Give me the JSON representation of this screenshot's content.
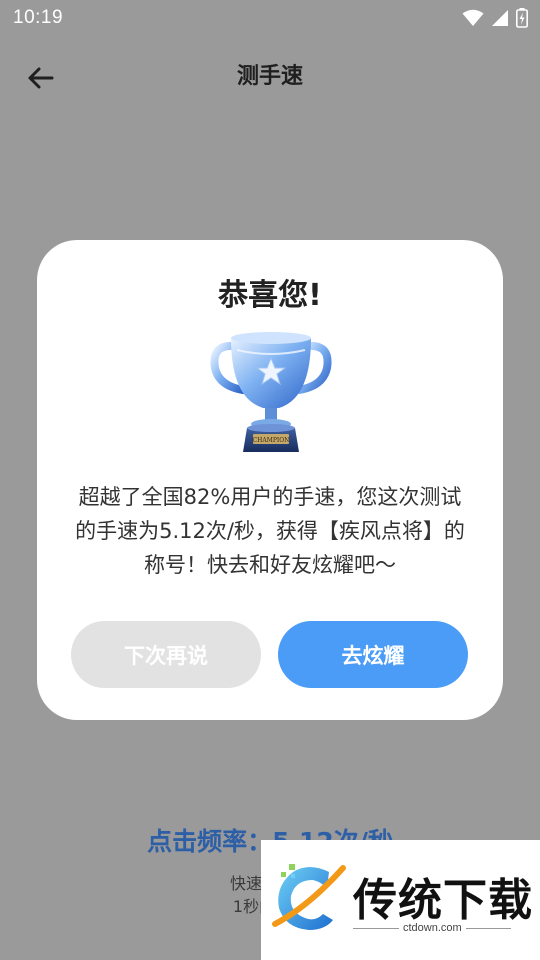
{
  "status_bar": {
    "time": "10:19",
    "icons": [
      "wifi-icon",
      "signal-icon",
      "battery-icon"
    ]
  },
  "header": {
    "title": "测手速",
    "back_icon": "arrow-left-icon"
  },
  "background": {
    "rate_text": "点击频率：5.12次/秒",
    "hint_line1": "快速点击屏",
    "hint_line2": "1秒内无操"
  },
  "dialog": {
    "title": "恭喜您!",
    "trophy_label": "CHAMPION",
    "message": "超越了全国82%用户的手速，您这次测试的手速为5.12次/秒，获得【疾风点将】的称号！快去和好友炫耀吧～",
    "later_button": "下次再说",
    "show_button": "去炫耀"
  },
  "watermark": {
    "name": "传统下载",
    "url": "ctdown.com"
  },
  "colors": {
    "overlay": "#9a9a9a",
    "primary": "#4a9cf7",
    "secondary_button": "#e2e2e2",
    "rate_text": "#2d5fa6"
  }
}
